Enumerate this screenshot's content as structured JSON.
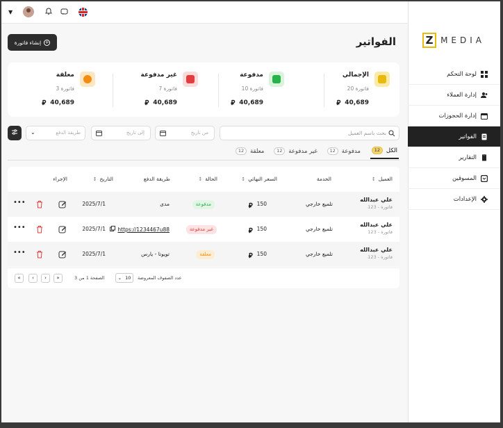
{
  "sidebar": {
    "logo_letter": "Z",
    "logo_text": "MEDIA",
    "items": [
      {
        "label": "لوحة التحكم",
        "icon": "dashboard-icon"
      },
      {
        "label": "إدارة العملاء",
        "icon": "users-icon"
      },
      {
        "label": "إدارة الحجوزات",
        "icon": "calendar-icon"
      },
      {
        "label": "الفواتير",
        "icon": "invoice-icon",
        "active": true
      },
      {
        "label": "التقارير",
        "icon": "report-icon"
      },
      {
        "label": "المسوقين",
        "icon": "marketer-icon"
      },
      {
        "label": "الإعدادات",
        "icon": "settings-icon"
      }
    ]
  },
  "header": {
    "title": "الفواتير",
    "create_label": "إنشاء فاتورة"
  },
  "stats": [
    {
      "title": "الإجمالي",
      "sub": "20 فاتورة",
      "value": "40,689",
      "icon": "receipt-icon",
      "bg": "#fbe9a6",
      "fg": "#e8b90e"
    },
    {
      "title": "مدفوعة",
      "sub": "10 فاتورة",
      "value": "40,689",
      "icon": "paid-icon",
      "bg": "#d9f3dd",
      "fg": "#27b24a"
    },
    {
      "title": "غير مدفوعة",
      "sub": "7 فاتورة",
      "value": "40,689",
      "icon": "unpaid-icon",
      "bg": "#fbdada",
      "fg": "#e33e3e"
    },
    {
      "title": "معلقة",
      "sub": "3 فاتورة",
      "value": "40,689",
      "icon": "pending-icon",
      "bg": "#fde6c2",
      "fg": "#f28c12"
    }
  ],
  "currency_symbol": "⃁",
  "filters": {
    "search_placeholder": "بحث باسم العميل",
    "from_date": "من تاريخ",
    "to_date": "إلى تاريخ",
    "payment_method": "طريقة الدفع"
  },
  "tabs": [
    {
      "label": "الكل",
      "count": "12",
      "active": true
    },
    {
      "label": "مدفوعة",
      "count": "12"
    },
    {
      "label": "غير مدفوعة",
      "count": "12"
    },
    {
      "label": "معلقة",
      "count": "12"
    }
  ],
  "table": {
    "headers": {
      "customer": "العميل",
      "service": "الخدمة",
      "final_price": "السعر النهائي",
      "status": "الحالة",
      "payment": "طريقة الدفع",
      "date": "التاريخ",
      "action": "الإجراء"
    },
    "rows": [
      {
        "name": "علي عبدالله",
        "invoice": "فاتورة - 123",
        "service": "تلميع خارجي",
        "price": "150",
        "status": "مدفوعة",
        "status_color": "#27b24a",
        "status_bg": "#e3f6e6",
        "payment": "مدى",
        "date": "2025/7/1"
      },
      {
        "name": "علي عبدالله",
        "invoice": "فاتورة - 123",
        "service": "تلميع خارجي",
        "price": "150",
        "status": "غير مدفوعة",
        "status_color": "#e33e3e",
        "status_bg": "#fde3e3",
        "payment": "https://1234467u88",
        "date": "2025/7/1"
      },
      {
        "name": "علي عبدالله",
        "invoice": "فاتورة - 123",
        "service": "تلميع خارجي",
        "price": "150",
        "status": "معلقة",
        "status_color": "#f28c12",
        "status_bg": "#fdeed3",
        "payment": "تويوتا - يارس",
        "date": "2025/7/1"
      }
    ]
  },
  "pager": {
    "rows_label": "عدد الصفوف المعروضة",
    "rows_value": "10",
    "page_info": "الصفحة 1 من 3"
  }
}
